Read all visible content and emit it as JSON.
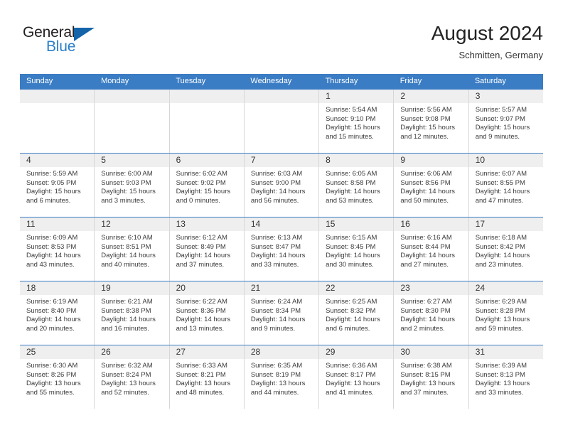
{
  "brand": {
    "name_part1": "General",
    "name_part2": "Blue",
    "accent_color": "#2a7fc9",
    "triangle_color": "#1464aa"
  },
  "header": {
    "month_title": "August 2024",
    "location": "Schmitten, Germany"
  },
  "calendar": {
    "header_bg": "#3b7dc4",
    "day_band_bg": "#efeff0",
    "weekdays": [
      "Sunday",
      "Monday",
      "Tuesday",
      "Wednesday",
      "Thursday",
      "Friday",
      "Saturday"
    ],
    "weeks": [
      [
        {
          "day": "",
          "empty": true
        },
        {
          "day": "",
          "empty": true
        },
        {
          "day": "",
          "empty": true
        },
        {
          "day": "",
          "empty": true
        },
        {
          "day": "1",
          "sunrise": "Sunrise: 5:54 AM",
          "sunset": "Sunset: 9:10 PM",
          "daylight": "Daylight: 15 hours and 15 minutes."
        },
        {
          "day": "2",
          "sunrise": "Sunrise: 5:56 AM",
          "sunset": "Sunset: 9:08 PM",
          "daylight": "Daylight: 15 hours and 12 minutes."
        },
        {
          "day": "3",
          "sunrise": "Sunrise: 5:57 AM",
          "sunset": "Sunset: 9:07 PM",
          "daylight": "Daylight: 15 hours and 9 minutes."
        }
      ],
      [
        {
          "day": "4",
          "sunrise": "Sunrise: 5:59 AM",
          "sunset": "Sunset: 9:05 PM",
          "daylight": "Daylight: 15 hours and 6 minutes."
        },
        {
          "day": "5",
          "sunrise": "Sunrise: 6:00 AM",
          "sunset": "Sunset: 9:03 PM",
          "daylight": "Daylight: 15 hours and 3 minutes."
        },
        {
          "day": "6",
          "sunrise": "Sunrise: 6:02 AM",
          "sunset": "Sunset: 9:02 PM",
          "daylight": "Daylight: 15 hours and 0 minutes."
        },
        {
          "day": "7",
          "sunrise": "Sunrise: 6:03 AM",
          "sunset": "Sunset: 9:00 PM",
          "daylight": "Daylight: 14 hours and 56 minutes."
        },
        {
          "day": "8",
          "sunrise": "Sunrise: 6:05 AM",
          "sunset": "Sunset: 8:58 PM",
          "daylight": "Daylight: 14 hours and 53 minutes."
        },
        {
          "day": "9",
          "sunrise": "Sunrise: 6:06 AM",
          "sunset": "Sunset: 8:56 PM",
          "daylight": "Daylight: 14 hours and 50 minutes."
        },
        {
          "day": "10",
          "sunrise": "Sunrise: 6:07 AM",
          "sunset": "Sunset: 8:55 PM",
          "daylight": "Daylight: 14 hours and 47 minutes."
        }
      ],
      [
        {
          "day": "11",
          "sunrise": "Sunrise: 6:09 AM",
          "sunset": "Sunset: 8:53 PM",
          "daylight": "Daylight: 14 hours and 43 minutes."
        },
        {
          "day": "12",
          "sunrise": "Sunrise: 6:10 AM",
          "sunset": "Sunset: 8:51 PM",
          "daylight": "Daylight: 14 hours and 40 minutes."
        },
        {
          "day": "13",
          "sunrise": "Sunrise: 6:12 AM",
          "sunset": "Sunset: 8:49 PM",
          "daylight": "Daylight: 14 hours and 37 minutes."
        },
        {
          "day": "14",
          "sunrise": "Sunrise: 6:13 AM",
          "sunset": "Sunset: 8:47 PM",
          "daylight": "Daylight: 14 hours and 33 minutes."
        },
        {
          "day": "15",
          "sunrise": "Sunrise: 6:15 AM",
          "sunset": "Sunset: 8:45 PM",
          "daylight": "Daylight: 14 hours and 30 minutes."
        },
        {
          "day": "16",
          "sunrise": "Sunrise: 6:16 AM",
          "sunset": "Sunset: 8:44 PM",
          "daylight": "Daylight: 14 hours and 27 minutes."
        },
        {
          "day": "17",
          "sunrise": "Sunrise: 6:18 AM",
          "sunset": "Sunset: 8:42 PM",
          "daylight": "Daylight: 14 hours and 23 minutes."
        }
      ],
      [
        {
          "day": "18",
          "sunrise": "Sunrise: 6:19 AM",
          "sunset": "Sunset: 8:40 PM",
          "daylight": "Daylight: 14 hours and 20 minutes."
        },
        {
          "day": "19",
          "sunrise": "Sunrise: 6:21 AM",
          "sunset": "Sunset: 8:38 PM",
          "daylight": "Daylight: 14 hours and 16 minutes."
        },
        {
          "day": "20",
          "sunrise": "Sunrise: 6:22 AM",
          "sunset": "Sunset: 8:36 PM",
          "daylight": "Daylight: 14 hours and 13 minutes."
        },
        {
          "day": "21",
          "sunrise": "Sunrise: 6:24 AM",
          "sunset": "Sunset: 8:34 PM",
          "daylight": "Daylight: 14 hours and 9 minutes."
        },
        {
          "day": "22",
          "sunrise": "Sunrise: 6:25 AM",
          "sunset": "Sunset: 8:32 PM",
          "daylight": "Daylight: 14 hours and 6 minutes."
        },
        {
          "day": "23",
          "sunrise": "Sunrise: 6:27 AM",
          "sunset": "Sunset: 8:30 PM",
          "daylight": "Daylight: 14 hours and 2 minutes."
        },
        {
          "day": "24",
          "sunrise": "Sunrise: 6:29 AM",
          "sunset": "Sunset: 8:28 PM",
          "daylight": "Daylight: 13 hours and 59 minutes."
        }
      ],
      [
        {
          "day": "25",
          "sunrise": "Sunrise: 6:30 AM",
          "sunset": "Sunset: 8:26 PM",
          "daylight": "Daylight: 13 hours and 55 minutes."
        },
        {
          "day": "26",
          "sunrise": "Sunrise: 6:32 AM",
          "sunset": "Sunset: 8:24 PM",
          "daylight": "Daylight: 13 hours and 52 minutes."
        },
        {
          "day": "27",
          "sunrise": "Sunrise: 6:33 AM",
          "sunset": "Sunset: 8:21 PM",
          "daylight": "Daylight: 13 hours and 48 minutes."
        },
        {
          "day": "28",
          "sunrise": "Sunrise: 6:35 AM",
          "sunset": "Sunset: 8:19 PM",
          "daylight": "Daylight: 13 hours and 44 minutes."
        },
        {
          "day": "29",
          "sunrise": "Sunrise: 6:36 AM",
          "sunset": "Sunset: 8:17 PM",
          "daylight": "Daylight: 13 hours and 41 minutes."
        },
        {
          "day": "30",
          "sunrise": "Sunrise: 6:38 AM",
          "sunset": "Sunset: 8:15 PM",
          "daylight": "Daylight: 13 hours and 37 minutes."
        },
        {
          "day": "31",
          "sunrise": "Sunrise: 6:39 AM",
          "sunset": "Sunset: 8:13 PM",
          "daylight": "Daylight: 13 hours and 33 minutes."
        }
      ]
    ]
  }
}
